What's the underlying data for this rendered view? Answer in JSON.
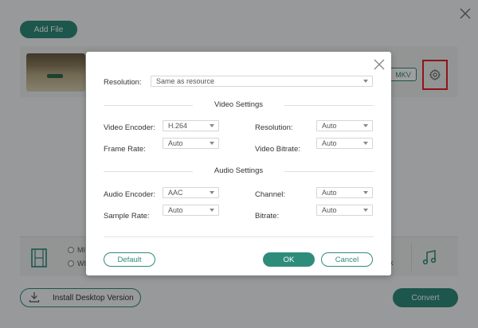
{
  "background": {
    "add_file": "Add File",
    "format_badge": "MKV",
    "radio_1": "MI",
    "radio_2": "WI",
    "partial_right": "k",
    "install": "Install Desktop Version",
    "convert": "Convert"
  },
  "dialog": {
    "resolution_label": "Resolution:",
    "resolution_value": "Same as resource",
    "video_section": "Video Settings",
    "video": {
      "encoder_label": "Video Encoder:",
      "encoder_value": "H.264",
      "framerate_label": "Frame Rate:",
      "framerate_value": "Auto",
      "resolution_label": "Resolution:",
      "resolution_value": "Auto",
      "bitrate_label": "Video Bitrate:",
      "bitrate_value": "Auto"
    },
    "audio_section": "Audio Settings",
    "audio": {
      "encoder_label": "Audio Encoder:",
      "encoder_value": "AAC",
      "samplerate_label": "Sample Rate:",
      "samplerate_value": "Auto",
      "channel_label": "Channel:",
      "channel_value": "Auto",
      "bitrate_label": "Bitrate:",
      "bitrate_value": "Auto"
    },
    "default_btn": "Default",
    "ok_btn": "OK",
    "cancel_btn": "Cancel"
  },
  "colors": {
    "accent": "#2e8c7b",
    "highlight_box": "#e8202a"
  },
  "icons": [
    "close-icon",
    "gear-icon",
    "film-icon",
    "music-icon",
    "download-icon",
    "caret-down-icon"
  ]
}
